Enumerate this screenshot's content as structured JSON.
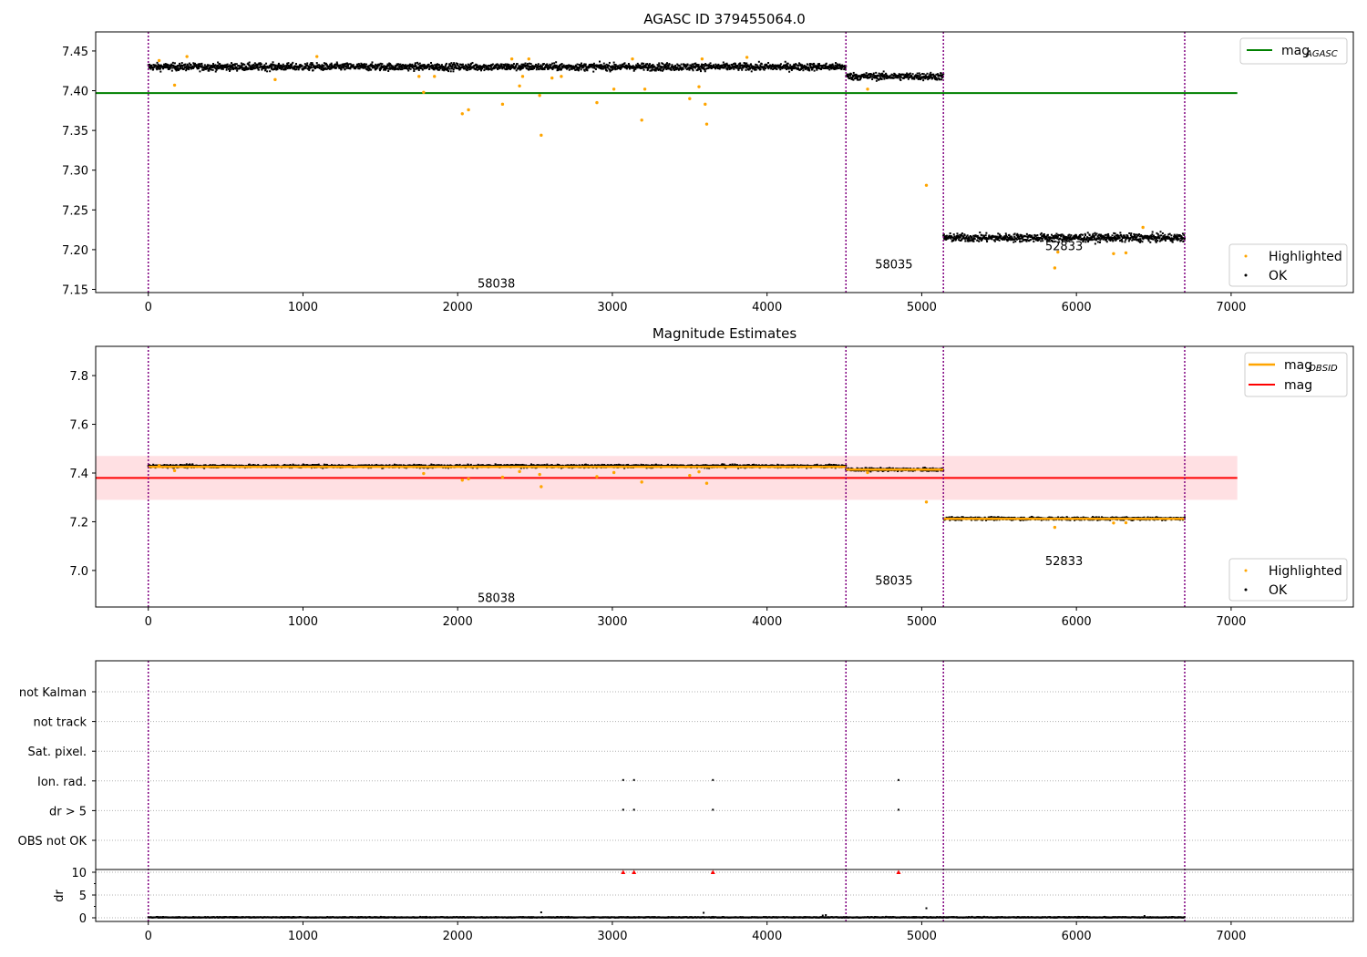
{
  "colors": {
    "ok": "#000000",
    "highlighted": "#ffa500",
    "agasc_line": "#008000",
    "mean_line": "#ff0000",
    "band": "#ffe0e3",
    "obsid_line": "#ffa500",
    "obs_sep": "#800080",
    "flag_marker": "#ff0000",
    "grid": "#b0b0b0"
  },
  "chart_data": [
    {
      "type": "scatter",
      "title": "AGASC ID 379455064.0",
      "xlim": [
        -340,
        7790
      ],
      "ylim": [
        7.146,
        7.474
      ],
      "xticks": [
        0,
        1000,
        2000,
        3000,
        4000,
        5000,
        6000,
        7000
      ],
      "yticks": [
        7.15,
        7.2,
        7.25,
        7.3,
        7.35,
        7.4,
        7.45
      ],
      "obs_boundaries": [
        0,
        4510,
        5140,
        6700
      ],
      "obs_labels": [
        {
          "text": "58038",
          "x": 2250,
          "y": 7.158
        },
        {
          "text": "58035",
          "x": 4820,
          "y": 7.182
        },
        {
          "text": "52833",
          "x": 5920,
          "y": 7.205
        }
      ],
      "hlines": [
        {
          "label": "mag",
          "sub": "AGASC",
          "y": 7.397,
          "x0": -340,
          "x1": 7040,
          "color": "agasc_line"
        }
      ],
      "ok_segments": [
        {
          "x0": 0,
          "x1": 4510,
          "center": 7.43,
          "spread": 0.0045
        },
        {
          "x0": 4510,
          "x1": 5140,
          "center": 7.418,
          "spread": 0.0045
        },
        {
          "x0": 5140,
          "x1": 6700,
          "center": 7.215,
          "spread": 0.005
        }
      ],
      "highlighted_points": [
        [
          70,
          7.438
        ],
        [
          170,
          7.407
        ],
        [
          250,
          7.443
        ],
        [
          820,
          7.414
        ],
        [
          1090,
          7.443
        ],
        [
          1750,
          7.418
        ],
        [
          1780,
          7.398
        ],
        [
          1850,
          7.418
        ],
        [
          2030,
          7.371
        ],
        [
          2070,
          7.376
        ],
        [
          2290,
          7.383
        ],
        [
          2350,
          7.44
        ],
        [
          2400,
          7.406
        ],
        [
          2420,
          7.418
        ],
        [
          2460,
          7.44
        ],
        [
          2530,
          7.394
        ],
        [
          2540,
          7.344
        ],
        [
          2610,
          7.416
        ],
        [
          2670,
          7.418
        ],
        [
          2900,
          7.385
        ],
        [
          3010,
          7.402
        ],
        [
          3130,
          7.44
        ],
        [
          3190,
          7.363
        ],
        [
          3210,
          7.402
        ],
        [
          3500,
          7.39
        ],
        [
          3560,
          7.405
        ],
        [
          3580,
          7.44
        ],
        [
          3600,
          7.383
        ],
        [
          3610,
          7.358
        ],
        [
          3870,
          7.442
        ],
        [
          4650,
          7.402
        ],
        [
          5030,
          7.281
        ],
        [
          5860,
          7.177
        ],
        [
          5880,
          7.197
        ],
        [
          6240,
          7.195
        ],
        [
          6320,
          7.196
        ],
        [
          6430,
          7.228
        ]
      ],
      "legend": {
        "ok": "OK",
        "highlighted": "Highlighted"
      }
    },
    {
      "type": "scatter",
      "title": "Magnitude Estimates",
      "xlim": [
        -340,
        7790
      ],
      "ylim": [
        6.85,
        7.92
      ],
      "xticks": [
        0,
        1000,
        2000,
        3000,
        4000,
        5000,
        6000,
        7000
      ],
      "yticks": [
        7.0,
        7.2,
        7.4,
        7.6,
        7.8
      ],
      "obs_boundaries": [
        0,
        4510,
        5140,
        6700
      ],
      "obs_labels": [
        {
          "text": "58038",
          "x": 2250,
          "y": 6.89
        },
        {
          "text": "58035",
          "x": 4820,
          "y": 6.96
        },
        {
          "text": "52833",
          "x": 5920,
          "y": 7.04
        }
      ],
      "band": {
        "y0": 7.29,
        "y1": 7.47,
        "x0": -340,
        "x1": 7040
      },
      "mean_line": {
        "label": "mag",
        "y": 7.38,
        "x0": -340,
        "x1": 7040
      },
      "obsid_segments": [
        {
          "x0": 0,
          "x1": 4510,
          "y": 7.425
        },
        {
          "x0": 4510,
          "x1": 5140,
          "y": 7.414
        },
        {
          "x0": 5140,
          "x1": 6700,
          "y": 7.212
        }
      ],
      "obsid_label": {
        "main": "mag",
        "sub": "OBSID"
      },
      "ok_segments": [
        {
          "x0": 0,
          "x1": 4510,
          "center": 7.428,
          "spread": 0.006
        },
        {
          "x0": 4510,
          "x1": 5140,
          "center": 7.414,
          "spread": 0.006
        },
        {
          "x0": 5140,
          "x1": 6700,
          "center": 7.213,
          "spread": 0.006
        }
      ],
      "highlighted_points": [
        [
          70,
          7.43
        ],
        [
          170,
          7.41
        ],
        [
          1780,
          7.398
        ],
        [
          2030,
          7.371
        ],
        [
          2070,
          7.376
        ],
        [
          2290,
          7.383
        ],
        [
          2400,
          7.406
        ],
        [
          2530,
          7.394
        ],
        [
          2540,
          7.344
        ],
        [
          2900,
          7.385
        ],
        [
          3010,
          7.402
        ],
        [
          3190,
          7.363
        ],
        [
          3500,
          7.39
        ],
        [
          3560,
          7.405
        ],
        [
          3610,
          7.358
        ],
        [
          4650,
          7.402
        ],
        [
          5030,
          7.281
        ],
        [
          5860,
          7.177
        ],
        [
          6240,
          7.195
        ],
        [
          6320,
          7.196
        ]
      ],
      "legend": {
        "ok": "OK",
        "highlighted": "Highlighted"
      }
    },
    {
      "type": "scatter",
      "title": "",
      "xlim": [
        -340,
        7790
      ],
      "xticks": [
        0,
        1000,
        2000,
        3000,
        4000,
        5000,
        6000,
        7000
      ],
      "obs_boundaries": [
        0,
        4510,
        5140,
        6700
      ],
      "flag_rows": [
        "not Kalman",
        "not track",
        "Sat. pixel.",
        "Ion. rad.",
        "dr > 5",
        "OBS not OK"
      ],
      "flag_points": {
        "Ion. rad.": [
          3070,
          3140,
          3650,
          4850
        ],
        "dr > 5": [
          3070,
          3140,
          3650,
          4850
        ]
      },
      "dr": {
        "ylabel": "dr",
        "ylim": [
          -0.8,
          10.6
        ],
        "yticks": [
          0,
          5,
          10
        ],
        "clipped_x": [
          3070,
          3140,
          3650,
          4850
        ],
        "clipped_y": 10,
        "outliers": [
          [
            2540,
            1.2
          ],
          [
            3590,
            1.1
          ],
          [
            5030,
            2.1
          ],
          [
            4360,
            0.5
          ],
          [
            4380,
            0.6
          ],
          [
            6440,
            0.4
          ]
        ]
      }
    }
  ]
}
